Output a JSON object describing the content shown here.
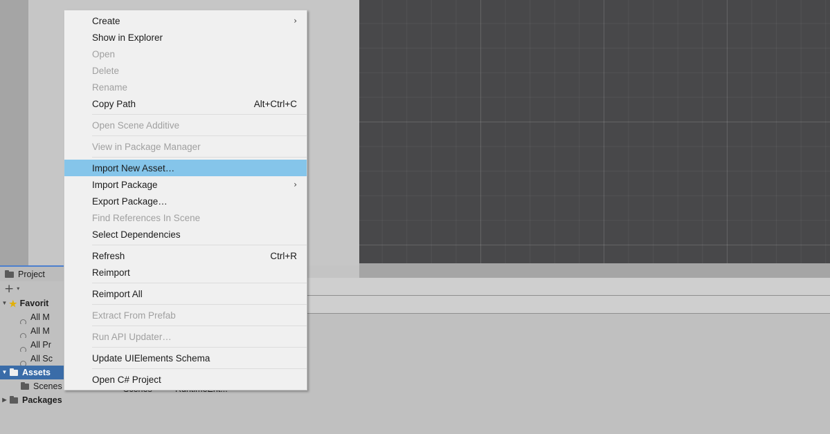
{
  "scene_view": {
    "name": "scene-view",
    "background_color": "#48484a",
    "grid_color": "#565658",
    "camera_bounds_color": "#d8d8d8"
  },
  "project_panel": {
    "tab_label": "Project",
    "tab_icon": "folder-icon",
    "add_button_label": "+",
    "add_button_caret": "▾",
    "tree": [
      {
        "label": "Favorit",
        "icon": "star-icon",
        "triangle": "▼",
        "depth": 0,
        "bold": true,
        "selected": false
      },
      {
        "label": "All M",
        "icon": "search-icon",
        "triangle": "",
        "depth": 1,
        "bold": false,
        "selected": false
      },
      {
        "label": "All M",
        "icon": "search-icon",
        "triangle": "",
        "depth": 1,
        "bold": false,
        "selected": false
      },
      {
        "label": "All Pr",
        "icon": "search-icon",
        "triangle": "",
        "depth": 1,
        "bold": false,
        "selected": false
      },
      {
        "label": "All Sc",
        "icon": "search-icon",
        "triangle": "",
        "depth": 1,
        "bold": false,
        "selected": false
      },
      {
        "label": "Assets",
        "icon": "folder-open-icon",
        "triangle": "▼",
        "depth": 0,
        "bold": true,
        "selected": true
      },
      {
        "label": "Scenes",
        "icon": "folder-icon",
        "triangle": "",
        "depth": 1,
        "bold": false,
        "selected": false
      },
      {
        "label": "Packages",
        "icon": "folder-icon",
        "triangle": "▶",
        "depth": 0,
        "bold": true,
        "selected": false
      }
    ],
    "selection_color": "#3a6ca8"
  },
  "asset_grid": {
    "items": [
      {
        "label": "Scenes"
      },
      {
        "label": "RuntimeEnt..."
      }
    ]
  },
  "context_menu": {
    "highlight_color": "#85c5ea",
    "background_color": "#f0f0f0",
    "items": [
      {
        "type": "item",
        "label": "Create",
        "shortcut": "",
        "submenu": "›",
        "disabled": false,
        "highlight": false
      },
      {
        "type": "item",
        "label": "Show in Explorer",
        "shortcut": "",
        "submenu": "",
        "disabled": false,
        "highlight": false
      },
      {
        "type": "item",
        "label": "Open",
        "shortcut": "",
        "submenu": "",
        "disabled": true,
        "highlight": false
      },
      {
        "type": "item",
        "label": "Delete",
        "shortcut": "",
        "submenu": "",
        "disabled": true,
        "highlight": false
      },
      {
        "type": "item",
        "label": "Rename",
        "shortcut": "",
        "submenu": "",
        "disabled": true,
        "highlight": false
      },
      {
        "type": "item",
        "label": "Copy Path",
        "shortcut": "Alt+Ctrl+C",
        "submenu": "",
        "disabled": false,
        "highlight": false
      },
      {
        "type": "separator"
      },
      {
        "type": "item",
        "label": "Open Scene Additive",
        "shortcut": "",
        "submenu": "",
        "disabled": true,
        "highlight": false
      },
      {
        "type": "separator"
      },
      {
        "type": "item",
        "label": "View in Package Manager",
        "shortcut": "",
        "submenu": "",
        "disabled": true,
        "highlight": false
      },
      {
        "type": "separator"
      },
      {
        "type": "item",
        "label": "Import New Asset…",
        "shortcut": "",
        "submenu": "",
        "disabled": false,
        "highlight": true
      },
      {
        "type": "item",
        "label": "Import Package",
        "shortcut": "",
        "submenu": "›",
        "disabled": false,
        "highlight": false
      },
      {
        "type": "item",
        "label": "Export Package…",
        "shortcut": "",
        "submenu": "",
        "disabled": false,
        "highlight": false
      },
      {
        "type": "item",
        "label": "Find References In Scene",
        "shortcut": "",
        "submenu": "",
        "disabled": true,
        "highlight": false
      },
      {
        "type": "item",
        "label": "Select Dependencies",
        "shortcut": "",
        "submenu": "",
        "disabled": false,
        "highlight": false
      },
      {
        "type": "separator"
      },
      {
        "type": "item",
        "label": "Refresh",
        "shortcut": "Ctrl+R",
        "submenu": "",
        "disabled": false,
        "highlight": false
      },
      {
        "type": "item",
        "label": "Reimport",
        "shortcut": "",
        "submenu": "",
        "disabled": false,
        "highlight": false
      },
      {
        "type": "separator"
      },
      {
        "type": "item",
        "label": "Reimport All",
        "shortcut": "",
        "submenu": "",
        "disabled": false,
        "highlight": false
      },
      {
        "type": "separator"
      },
      {
        "type": "item",
        "label": "Extract From Prefab",
        "shortcut": "",
        "submenu": "",
        "disabled": true,
        "highlight": false
      },
      {
        "type": "separator"
      },
      {
        "type": "item",
        "label": "Run API Updater…",
        "shortcut": "",
        "submenu": "",
        "disabled": true,
        "highlight": false
      },
      {
        "type": "separator"
      },
      {
        "type": "item",
        "label": "Update UIElements Schema",
        "shortcut": "",
        "submenu": "",
        "disabled": false,
        "highlight": false
      },
      {
        "type": "separator"
      },
      {
        "type": "item",
        "label": "Open C# Project",
        "shortcut": "",
        "submenu": "",
        "disabled": false,
        "highlight": false
      }
    ]
  }
}
